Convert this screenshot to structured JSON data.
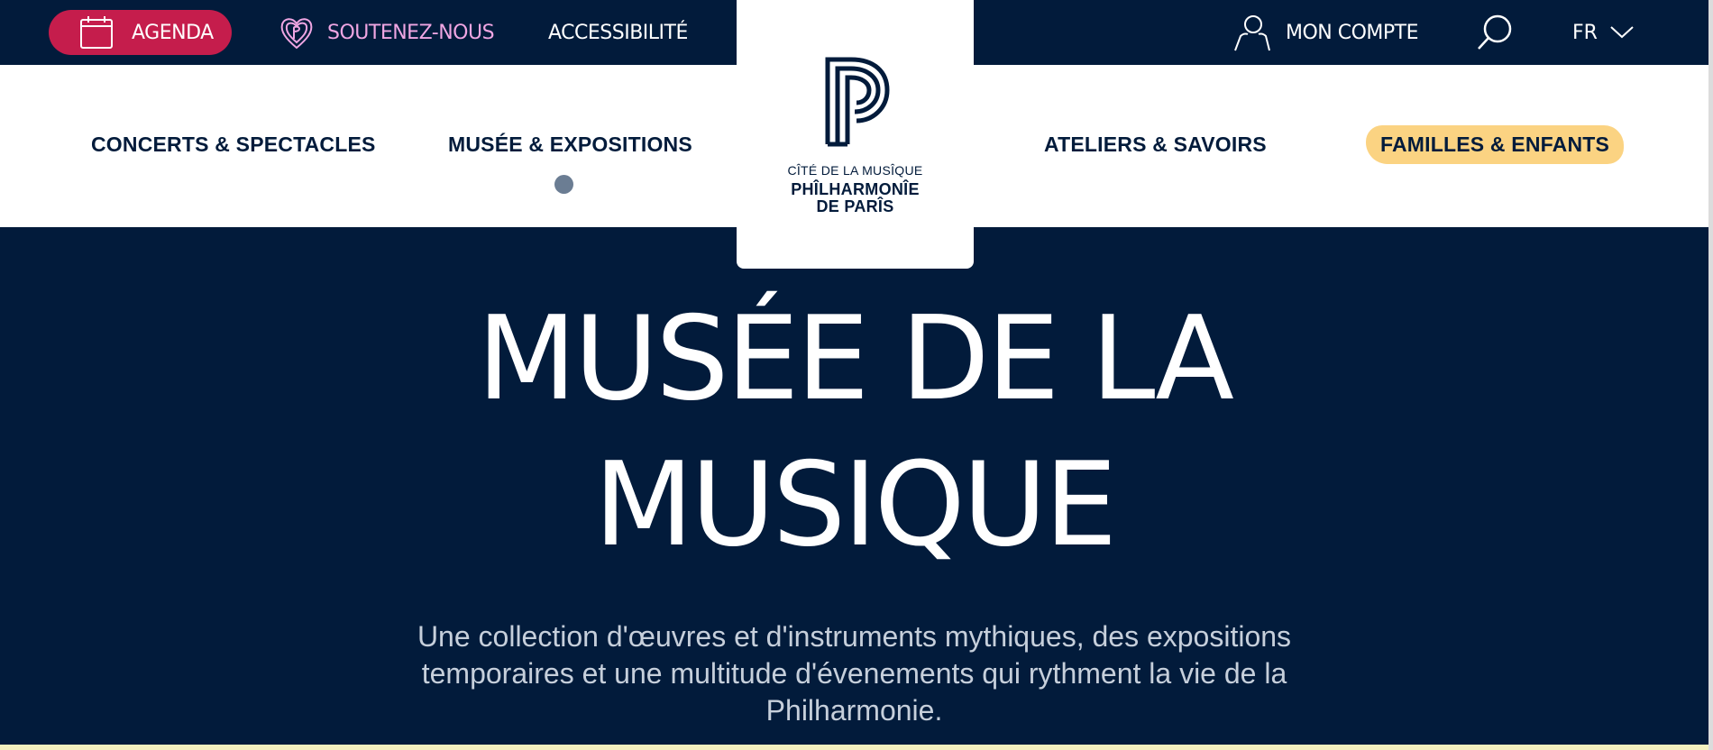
{
  "topbar": {
    "agenda_label": "AGENDA",
    "support_label": "SOUTENEZ-NOUS",
    "accessibility_label": "ACCESSIBILITÉ",
    "account_label": "MON COMPTE",
    "language": "FR"
  },
  "nav": {
    "items": [
      {
        "label": "CONCERTS & SPECTACLES"
      },
      {
        "label": "MUSÉE & EXPOSITIONS"
      },
      {
        "label": "ATELIERS & SAVOIRS"
      },
      {
        "label": "FAMILLES & ENFANTS"
      }
    ],
    "active_index": 1
  },
  "logo": {
    "line1": "CÎTÉ DE LA MUSÎQUE",
    "line2": "PHÎLHARMONÎE",
    "line3": "DE PARÎS"
  },
  "hero": {
    "title_line1": "MUSÉE DE LA",
    "title_line2": "MUSIQUE",
    "description": "Une collection d'œuvres et d'instruments mythiques, des expositions temporaires et une multitude d'évenements qui rythment la vie de la Philharmonie."
  },
  "colors": {
    "navy": "#021b3b",
    "agenda_red": "#c51d4c",
    "support_pink": "#f0a6e3",
    "familles_highlight": "#fbd382"
  },
  "icons": [
    "calendar-icon",
    "heart-logo-icon",
    "user-icon",
    "search-icon",
    "chevron-down-icon",
    "philharmonie-logo-icon"
  ]
}
